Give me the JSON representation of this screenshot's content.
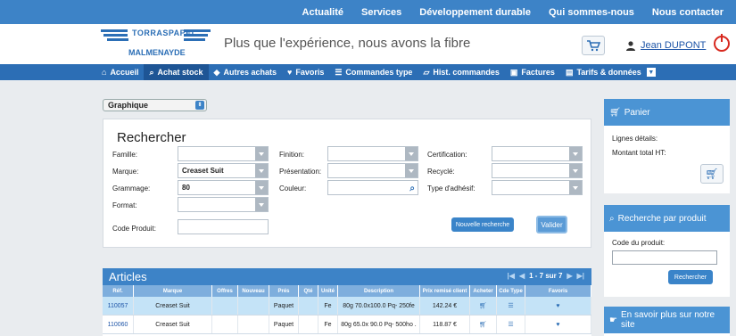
{
  "topnav": [
    "Actualité",
    "Services",
    "Développement durable",
    "Qui sommes-nous",
    "Nous contacter"
  ],
  "logo": {
    "line1": "TORRASPAPEL",
    "line2": "MALMENAYDE"
  },
  "tagline": "Plus que l'expérience, nous avons la fibre",
  "user": "Jean DUPONT",
  "nav": [
    {
      "label": "Accueil",
      "icon": "home-icon"
    },
    {
      "label": "Achat stock",
      "icon": "search-icon"
    },
    {
      "label": "Autres achats",
      "icon": "tag-icon"
    },
    {
      "label": "Favoris",
      "icon": "heart-icon"
    },
    {
      "label": "Commandes type",
      "icon": "list-icon"
    },
    {
      "label": "Hist. commandes",
      "icon": "tray-icon"
    },
    {
      "label": "Factures",
      "icon": "briefcase-icon"
    },
    {
      "label": "Tarifs & données",
      "icon": "document-icon"
    }
  ],
  "view_select": "Graphique",
  "search": {
    "title": "Rechercher",
    "labels": {
      "famille": "Famille:",
      "marque": "Marque:",
      "grammage": "Grammage:",
      "format": "Format:",
      "code": "Code Produit:",
      "finition": "Finition:",
      "presentation": "Présentation:",
      "couleur": "Couleur:",
      "certification": "Certification:",
      "recycle": "Recyclé:",
      "adhesif": "Type d'adhésif:"
    },
    "values": {
      "marque": "Creaset Suit",
      "grammage": "80"
    },
    "new_button": "Nouvelle recherche",
    "validate_button": "Valider"
  },
  "articles": {
    "title": "Articles",
    "pager": "1 - 7 sur 7",
    "columns": [
      "Réf.",
      "Marque",
      "Offres",
      "Nouveau",
      "Prés",
      "Qté",
      "Unité",
      "Description",
      "Prix remisé client",
      "Acheter",
      "Cde Type",
      "Favoris"
    ],
    "rows": [
      {
        "ref": "110057",
        "marque": "Creaset Suit",
        "pres": "Paquet",
        "unite": "Fe",
        "desc": "80g 70.0x100.0 Pq- 250fe",
        "prix": "142.24 €"
      },
      {
        "ref": "110060",
        "marque": "Creaset Suit",
        "pres": "Paquet",
        "unite": "Fe",
        "desc": "80g 65.0x 90.0 Pq- 500ho .",
        "prix": "118.87 €"
      }
    ]
  },
  "panier": {
    "title": "Panier",
    "lignes": "Lignes détails:",
    "montant": "Montant total HT:"
  },
  "recherche_produit": {
    "title": "Recherche par produit",
    "label": "Code du produit:",
    "button": "Rechercher"
  },
  "savoir": {
    "title": "En savoir plus sur notre site"
  }
}
